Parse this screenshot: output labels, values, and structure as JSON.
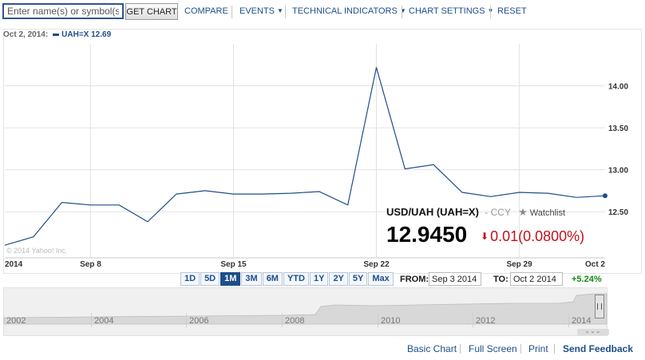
{
  "toolbar": {
    "symbol_placeholder": "Enter name(s) or symbol(s)",
    "get_chart_label": "GET CHART",
    "compare_label": "COMPARE",
    "events_label": "EVENTS",
    "technical_indicators_label": "TECHNICAL INDICATORS",
    "chart_settings_label": "CHART SETTINGS",
    "reset_label": "RESET",
    "caret_icon": "caret-down-icon"
  },
  "legend": {
    "date": "Oct 2, 2014:",
    "symbol_value": "UAH=X 12.69",
    "series_color": "#1d4e89"
  },
  "quote": {
    "name": "USD/UAH (UAH=X)",
    "separator": "-",
    "ccy": "CCY",
    "watchlist_label": "Watchlist",
    "price": "12.9450",
    "change": "0.01",
    "change_pct": "(0.0800%)",
    "change_color": "#c2111b",
    "change_icon": "down-arrow-icon",
    "watchlist_icon": "star-icon"
  },
  "watermark": "© 2014 Yahoo! Inc.",
  "ranges": {
    "buttons": [
      "1D",
      "5D",
      "1M",
      "3M",
      "6M",
      "YTD",
      "1Y",
      "2Y",
      "5Y",
      "Max"
    ],
    "active": "1M"
  },
  "date_range": {
    "from_label": "FROM:",
    "from_value": "Sep 3 2014",
    "to_label": "TO:",
    "to_value": "Oct 2 2014",
    "change": "+5.24%",
    "change_color": "#128812"
  },
  "navigator": {
    "years": [
      "2002",
      "2004",
      "2006",
      "2008",
      "2010",
      "2012",
      "2014"
    ],
    "scroll_grip": "⌄⌄⌄"
  },
  "footer": {
    "links": [
      "Basic Chart",
      "Full Screen",
      "Print",
      "Send Feedback"
    ]
  },
  "chart_data": {
    "type": "line",
    "x_labels": [
      "2014",
      "Sep 8",
      "Sep 15",
      "Sep 22",
      "Sep 29",
      "Oct 2"
    ],
    "y_ticks": [
      "14.00",
      "13.50",
      "13.00",
      "12.50"
    ],
    "ylim": [
      11.95,
      14.5
    ],
    "grid": true,
    "series": [
      {
        "name": "UAH=X",
        "color": "#1d4e89",
        "x": [
          "Sep 3",
          "Sep 4",
          "Sep 5",
          "Sep 8",
          "Sep 9",
          "Sep 10",
          "Sep 11",
          "Sep 12",
          "Sep 15",
          "Sep 16",
          "Sep 17",
          "Sep 18",
          "Sep 19",
          "Sep 22",
          "Sep 23",
          "Sep 24",
          "Sep 25",
          "Sep 26",
          "Sep 29",
          "Sep 30",
          "Oct 1",
          "Oct 2"
        ],
        "values": [
          12.1,
          12.2,
          12.61,
          12.58,
          12.58,
          12.38,
          12.71,
          12.75,
          12.71,
          12.71,
          12.72,
          12.74,
          12.58,
          14.22,
          13.01,
          13.06,
          12.73,
          12.68,
          12.73,
          12.72,
          12.67,
          12.69
        ]
      }
    ]
  }
}
